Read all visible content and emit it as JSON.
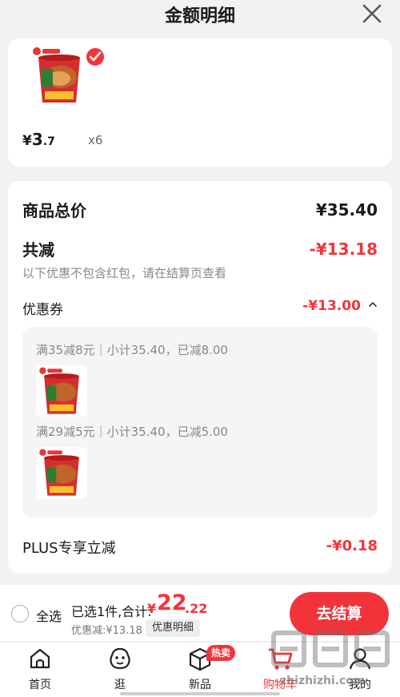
{
  "header": {
    "title": "金额明细"
  },
  "product": {
    "price_yen": "¥",
    "price_int": "3",
    "price_dec": ".7",
    "quantity": "x6"
  },
  "summary": {
    "total_label": "商品总价",
    "total_value": "¥35.40",
    "reduce_label": "共减",
    "reduce_value": "-¥13.18",
    "note": "以下优惠不包含红包，请在结算页查看",
    "coupon_label": "优惠券",
    "coupon_value": "-¥13.00",
    "coupons": [
      {
        "rule": "满35减8元｜小计35.40，已减8.00"
      },
      {
        "rule": "满29减5元｜小计35.40，已减5.00"
      }
    ],
    "plus_label": "PLUS专享立减",
    "plus_value": "-¥0.18"
  },
  "checkout": {
    "select_all": "全选",
    "selected_text": "已选1件,合计:",
    "total_yen": "¥",
    "total_int": "22",
    "total_dec": ".22",
    "discount_text": "优惠减:¥13.18",
    "detail_label": "优惠明细",
    "button_label": "去结算"
  },
  "tabbar": {
    "tabs": [
      {
        "label": "首页",
        "icon": "home-icon"
      },
      {
        "label": "逛",
        "icon": "face-icon"
      },
      {
        "label": "新品",
        "icon": "box-icon"
      },
      {
        "label": "购物车",
        "icon": "cart-icon"
      },
      {
        "label": "我的",
        "icon": "user-icon"
      }
    ],
    "hot_badge": "热卖"
  },
  "watermark": {
    "text": "zhizhizhi.com"
  },
  "colors": {
    "accent": "#f2343a",
    "background": "#f2f2f2"
  }
}
